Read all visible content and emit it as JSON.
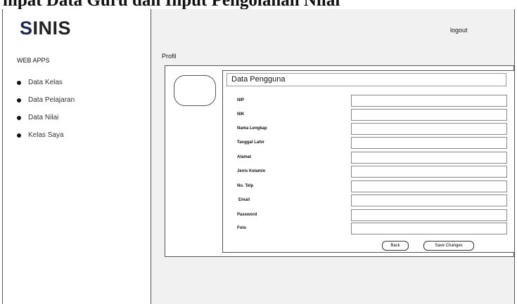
{
  "document_heading": "mpat Data Guru dan Input Pengolahan Nilai",
  "app": {
    "logo_first": "S",
    "logo_rest": "INIS",
    "logo_accent_color": "#1f2a52"
  },
  "sidebar": {
    "section_label": "WEB APPS",
    "items": [
      {
        "label": "Data Kelas"
      },
      {
        "label": "Data Pelajaran"
      },
      {
        "label": "Data Nilai"
      },
      {
        "label": "Kelas Saya"
      }
    ]
  },
  "header": {
    "logout_label": "logout"
  },
  "page": {
    "title": "Profil"
  },
  "form": {
    "title": "Data Pengguna",
    "fields": [
      {
        "label": "NIP",
        "value": ""
      },
      {
        "label": "NIK",
        "value": ""
      },
      {
        "label": "Nama Lengkap",
        "value": ""
      },
      {
        "label": "Tanggal Lahir",
        "value": ""
      },
      {
        "label": "Alamat",
        "value": ""
      },
      {
        "label": "Jenis Kelamin",
        "value": ""
      },
      {
        "label": "No. Telp",
        "value": ""
      },
      {
        "label": "Email",
        "value": ""
      },
      {
        "label": "Password",
        "value": ""
      },
      {
        "label": "Foto",
        "value": ""
      }
    ],
    "back_label": "Back",
    "save_label": "Save Changes"
  }
}
